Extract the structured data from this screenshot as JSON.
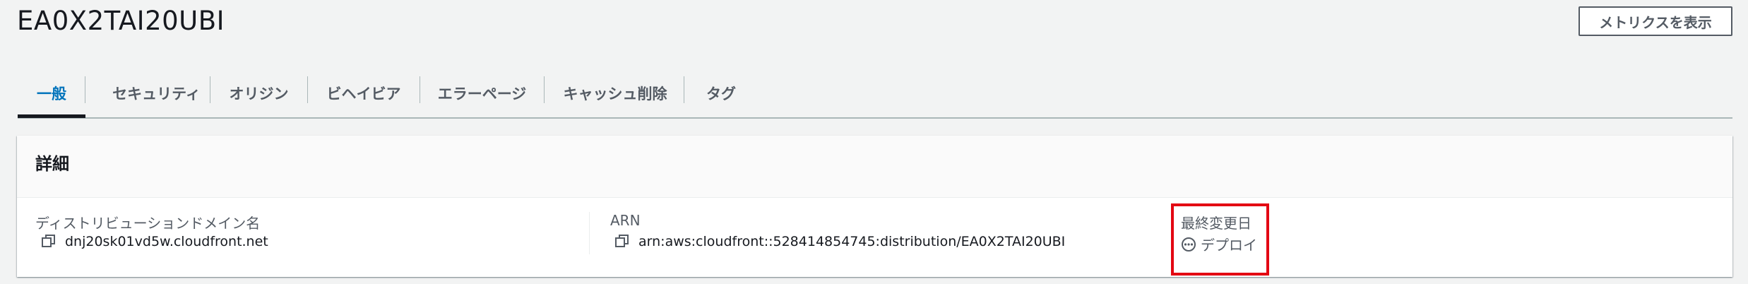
{
  "header": {
    "title": "EA0X2TAI20UBI",
    "metrics_button": "メトリクスを表示"
  },
  "tabs": [
    {
      "label": "一般",
      "active": true
    },
    {
      "label": "セキュリティ",
      "active": false
    },
    {
      "label": "オリジン",
      "active": false
    },
    {
      "label": "ビヘイビア",
      "active": false
    },
    {
      "label": "エラーページ",
      "active": false
    },
    {
      "label": "キャッシュ削除",
      "active": false
    },
    {
      "label": "タグ",
      "active": false
    }
  ],
  "details": {
    "title": "詳細",
    "domain_name": {
      "label": "ディストリビューションドメイン名",
      "value": "dnj20sk01vd5w.cloudfront.net",
      "icon": "copy-icon"
    },
    "arn": {
      "label": "ARN",
      "value": "arn:aws:cloudfront::528414854745:distribution/EA0X2TAI20UBI",
      "icon": "copy-icon"
    },
    "last_modified": {
      "label": "最終変更日",
      "value": "デプロイ",
      "icon": "in-progress-icon"
    }
  },
  "colors": {
    "active_tab": "#0073bb",
    "highlight": "#e30613",
    "text_secondary": "#545b64"
  }
}
